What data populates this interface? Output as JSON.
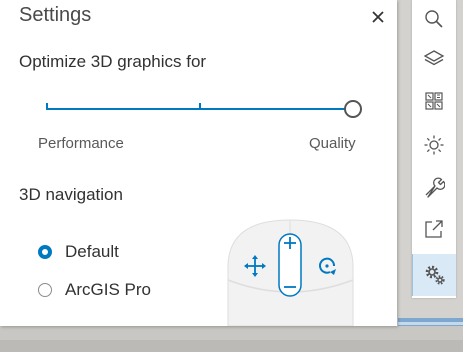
{
  "settings": {
    "title": "Settings",
    "graphics": {
      "label": "Optimize 3D graphics for",
      "left_label": "Performance",
      "right_label": "Quality",
      "value_fraction": 1.0
    },
    "navigation": {
      "label": "3D navigation",
      "options": [
        {
          "label": "Default",
          "checked": true
        },
        {
          "label": "ArcGIS Pro",
          "checked": false
        }
      ]
    }
  },
  "toolbar": {
    "tools": [
      {
        "icon": "search-icon"
      },
      {
        "icon": "layers-icon"
      },
      {
        "icon": "qr-grid-icon"
      },
      {
        "icon": "sun-icon"
      },
      {
        "icon": "wrench-icon"
      },
      {
        "icon": "share-icon"
      },
      {
        "icon": "gears-icon",
        "active": true
      }
    ]
  },
  "colors": {
    "accent": "#0079c1",
    "panel": "#ffffff",
    "active_tool_bg": "#d9e9f6"
  }
}
